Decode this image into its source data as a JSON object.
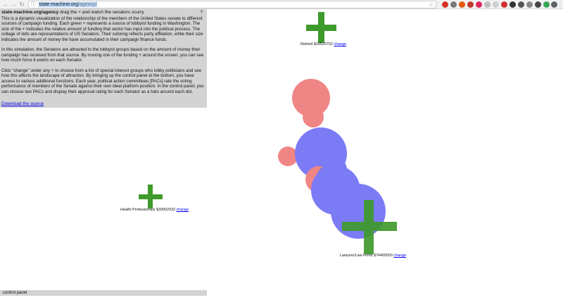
{
  "browser": {
    "url_host": "state-machine.org",
    "url_path": "/agency/"
  },
  "info": {
    "site_title": "state-machine.org/agency",
    "tagline": "drag the + and watch the senators scurry",
    "help": "?",
    "paragraphs": [
      "This is a dynamic visualization of the relationship of the members of the United States senate to different sources of campaign funding. Each green + represents a source of lobbyist funding in Washington. The size of the + indicates the relative amount of funding that sector has input into the political process. The collage of dots are representations of US Senators. Their coloring reflects party affiliation, while their size indicates the amount of money the have accumulated in their campaign finance funds.",
      "In this simulation, the Senators are attracted to the lobbyist groups based on the amount of money their campaign has received from that source. By moving one of the funding + around the screen, you can see how much force it exerts on each Senator.",
      "Click \"change\" under any + to choose from a list of special interest groups who lobby politicians and see how this affects the landscape of attraction. By bringing up the control panel at the bottom, you have access to various additional functions. Each year, political action committees [PACs] rate the voting performance of members of the Senate against their own ideal platform position. In the control panel, you can choose two PACs and display their approval rating for each Senator as a halo around each dot."
    ],
    "download_link": "Download the source"
  },
  "control_panel": {
    "label": "control panel"
  },
  "lobbies": [
    {
      "name": "Retired",
      "amount": "$39520702",
      "change_label": "change"
    },
    {
      "name": "Health Professionals",
      "amount": "$39902933",
      "change_label": "change"
    },
    {
      "name": "Lawyers/Law Firms",
      "amount": "$74460550",
      "change_label": "change"
    }
  ],
  "colors": {
    "plus": "#3f9a2c",
    "democrat": "#2b2bf2",
    "republican": "#e83b3b",
    "panel": "#d3d3d3",
    "link": "#0000ee"
  }
}
